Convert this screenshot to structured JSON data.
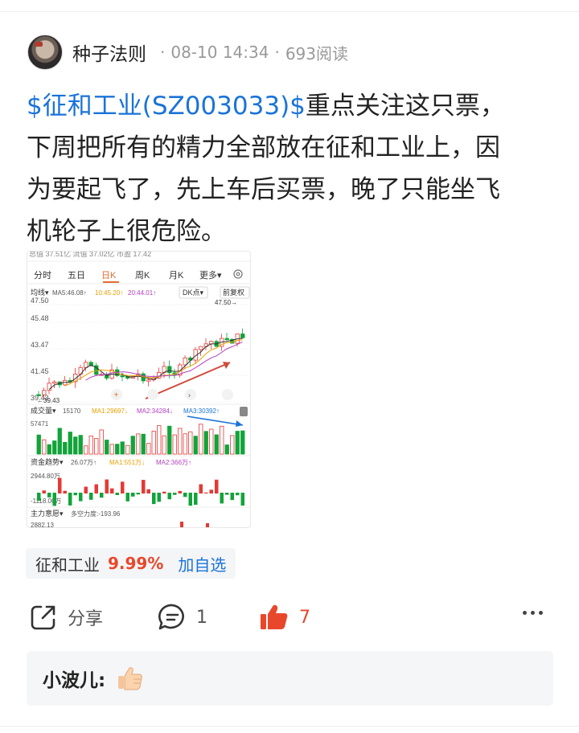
{
  "post": {
    "author": "种子法则",
    "time": "08-10 14:34",
    "views": "693阅读",
    "stock_tag": "$征和工业(SZ003033)$",
    "text_line1": "重点关注这只票，",
    "text_line2": "下周把所有的精力全部放在征和工业上，因",
    "text_line3": "为要起飞了，先上车后买票，晚了只能坐飞",
    "text_line4": "机轮子上很危险。"
  },
  "chart_thumb": {
    "top_info": "总值 37.51亿  流值 37.02亿  市盈 17.42",
    "tabs": [
      "分时",
      "五日",
      "日K",
      "周K",
      "月K",
      "更多"
    ],
    "active_tab": "日K",
    "ma_line": {
      "label": "均线",
      "ma5": "MA5:46.08↑",
      "ma10": "10:45.20↑",
      "ma20": "20:44.01↑",
      "dk": "DK点",
      "fq": "前复权"
    },
    "price_labels": [
      "47.50",
      "45.48",
      "43.47",
      "41.45",
      "39.43"
    ],
    "high_marker": "47.50→",
    "low_marker": "←39.43",
    "volume": {
      "label": "成交量",
      "value": "15170",
      "ma1": "MA1:29697↓",
      "ma2": "MA2:34284↓",
      "ma3": "MA3:30392↑",
      "max": "57471"
    },
    "fund": {
      "label": "资金趋势",
      "value": "26.07万↑",
      "ma1": "MA1:551万↓",
      "ma2": "MA2:366万↑",
      "max": "2944.80万",
      "min": "-1118.00万"
    },
    "intent": {
      "label": "主力意愿",
      "value": "多空力度:-193.96",
      "num": "2882.13"
    },
    "colors": {
      "up": "#e53935",
      "down": "#12a33a"
    }
  },
  "stock_chip": {
    "name": "征和工业",
    "change": "9.99%",
    "add": "加自选"
  },
  "actions": {
    "share": "分享",
    "comments": "1",
    "likes": "7"
  },
  "comment_preview": {
    "name": "小波儿:"
  },
  "icons": {
    "share": "share-icon",
    "comment": "comment-icon",
    "like": "thumbs-up-icon",
    "more": "more-icon",
    "emoji": "thumbs-up-emoji-icon"
  }
}
